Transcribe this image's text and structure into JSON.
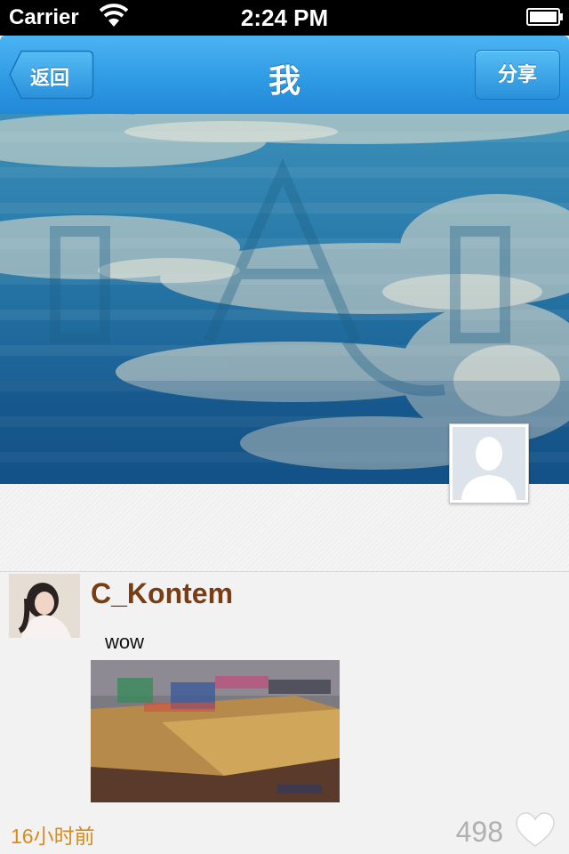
{
  "status_bar": {
    "carrier": "Carrier",
    "time": "2:24 PM"
  },
  "nav": {
    "back_label": "返回",
    "title": "我",
    "share_label": "分享"
  },
  "post": {
    "username": "C_Kontem",
    "text": "wow",
    "time": "16小时前",
    "likes": "498"
  },
  "colors": {
    "nav_accent": "#2f9be4",
    "username": "#7a3d12",
    "timestamp": "#d98a1c",
    "likes": "#b0b0b0"
  },
  "icons": {
    "wifi": "wifi-icon",
    "battery": "battery-icon",
    "heart": "heart-icon"
  }
}
